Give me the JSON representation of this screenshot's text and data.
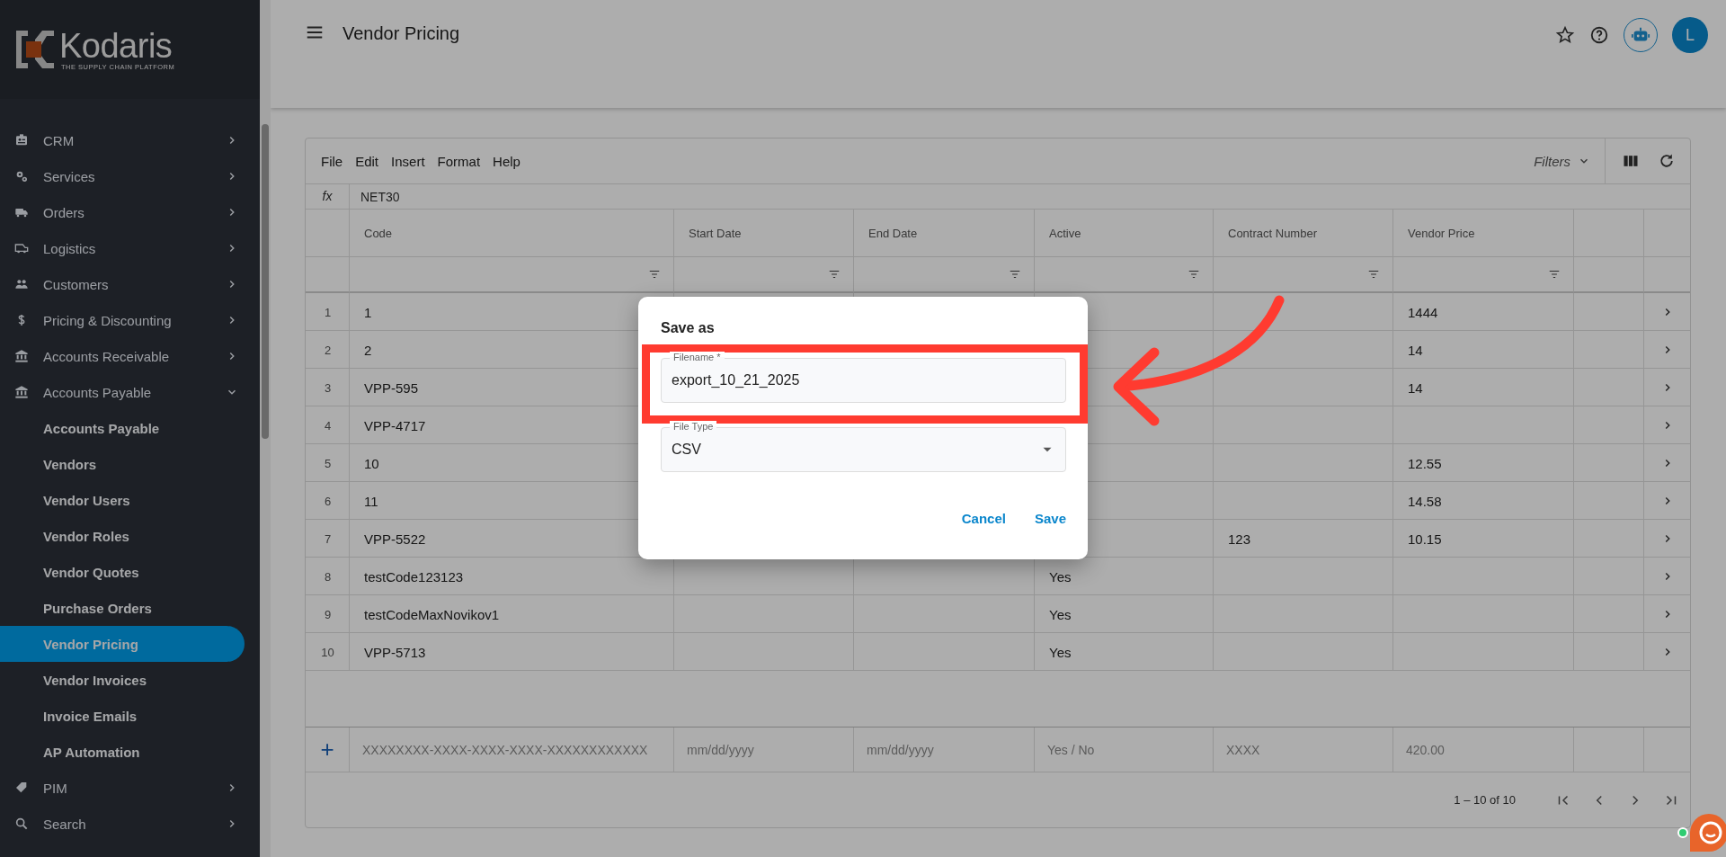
{
  "sidebar": {
    "logo": {
      "name": "Kodaris",
      "tagline": "THE SUPPLY CHAIN PLATFORM"
    },
    "items": [
      {
        "label": "CRM",
        "expanded": false
      },
      {
        "label": "Services",
        "expanded": false
      },
      {
        "label": "Orders",
        "expanded": false
      },
      {
        "label": "Logistics",
        "expanded": false
      },
      {
        "label": "Customers",
        "expanded": false
      },
      {
        "label": "Pricing & Discounting",
        "expanded": false
      },
      {
        "label": "Accounts Receivable",
        "expanded": false
      },
      {
        "label": "Accounts Payable",
        "expanded": true,
        "children": [
          {
            "label": "Accounts Payable",
            "selected": false
          },
          {
            "label": "Vendors",
            "selected": false
          },
          {
            "label": "Vendor Users",
            "selected": false
          },
          {
            "label": "Vendor Roles",
            "selected": false
          },
          {
            "label": "Vendor Quotes",
            "selected": false
          },
          {
            "label": "Purchase Orders",
            "selected": false
          },
          {
            "label": "Vendor Pricing",
            "selected": true
          },
          {
            "label": "Vendor Invoices",
            "selected": false
          },
          {
            "label": "Invoice Emails",
            "selected": false
          },
          {
            "label": "AP Automation",
            "selected": false
          }
        ]
      },
      {
        "label": "PIM",
        "expanded": false
      },
      {
        "label": "Search",
        "expanded": false
      }
    ]
  },
  "header": {
    "title": "Vendor Pricing",
    "avatar": "L"
  },
  "grid": {
    "menu": [
      "File",
      "Edit",
      "Insert",
      "Format",
      "Help"
    ],
    "filters": "Filters",
    "formula_label": "fx",
    "formula": "NET30",
    "columns": [
      "Code",
      "Start Date",
      "End Date",
      "Active",
      "Contract Number",
      "Vendor Price"
    ],
    "rows": [
      {
        "number": "1",
        "code": "1",
        "vendor_price": "1444"
      },
      {
        "number": "2",
        "code": "2",
        "vendor_price": "14"
      },
      {
        "number": "3",
        "code": "VPP-595",
        "vendor_price": "14"
      },
      {
        "number": "4",
        "code": "VPP-4717"
      },
      {
        "number": "5",
        "code": "10",
        "vendor_price": "12.55"
      },
      {
        "number": "6",
        "code": "11",
        "vendor_price": "14.58"
      },
      {
        "number": "7",
        "code": "VPP-5522",
        "contract_number": "123",
        "vendor_price": "10.15"
      },
      {
        "number": "8",
        "code": "testCode123123",
        "active": "Yes"
      },
      {
        "number": "9",
        "code": "testCodeMaxNovikov1",
        "active": "Yes"
      },
      {
        "number": "10",
        "code": "VPP-5713",
        "active": "Yes"
      }
    ],
    "new_row": {
      "add": "+",
      "placeholders": [
        "XXXXXXXX-XXXX-XXXX-XXXX-XXXXXXXXXXXX",
        "mm/dd/yyyy",
        "mm/dd/yyyy",
        "Yes / No",
        "XXXX",
        "420.00"
      ]
    },
    "pager": "1 – 10 of 10"
  },
  "dialog": {
    "title": "Save as",
    "filename": {
      "label": "Filename *",
      "value": "export_10_21_2025"
    },
    "file_type": {
      "label": "File Type",
      "value": "CSV"
    },
    "buttons": [
      "Cancel",
      "Save"
    ]
  }
}
